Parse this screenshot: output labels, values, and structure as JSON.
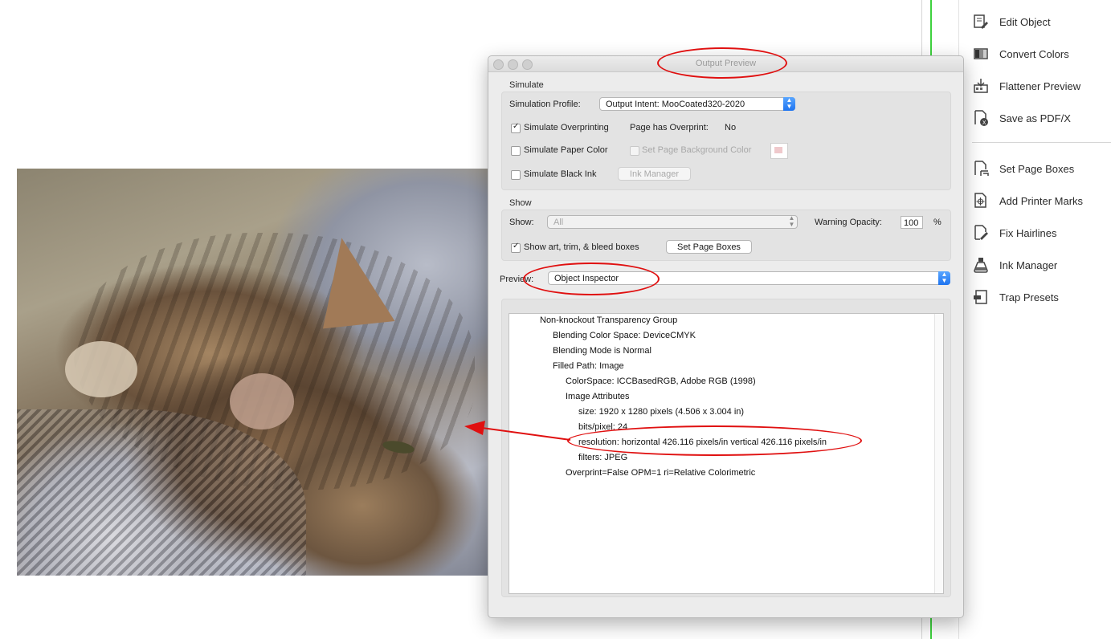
{
  "dialog": {
    "title": "Output Preview",
    "simulate": {
      "group_label": "Simulate",
      "profile_label": "Simulation Profile:",
      "profile_value": "Output Intent: MooCoated320-2020",
      "overprinting_label": "Simulate Overprinting",
      "overprinting_checked": true,
      "overprint_status_label": "Page has Overprint:",
      "overprint_status_value": "No",
      "paper_color_label": "Simulate Paper Color",
      "page_bg_label": "Set Page Background Color",
      "black_ink_label": "Simulate Black Ink",
      "ink_manager_button": "Ink Manager"
    },
    "show": {
      "group_label": "Show",
      "show_label": "Show:",
      "show_value": "All",
      "warning_opacity_label": "Warning Opacity:",
      "warning_opacity_value": "100",
      "percent_sign": "%",
      "boxes_label": "Show art, trim, & bleed boxes",
      "boxes_checked": true,
      "set_page_boxes_button": "Set Page Boxes"
    },
    "preview": {
      "label": "Preview:",
      "value": "Object Inspector"
    },
    "inspector_lines": [
      "Non-knockout Transparency Group",
      "Blending Color Space: DeviceCMYK",
      "Blending Mode is Normal",
      "Filled Path: Image",
      "ColorSpace: ICCBasedRGB, Adobe RGB (1998)",
      "Image Attributes",
      "size: 1920 x 1280 pixels (4.506 x 3.004 in)",
      "bits/pixel: 24",
      "resolution: horizontal 426.116 pixels/in vertical 426.116 pixels/in",
      "filters: JPEG",
      "Overprint=False OPM=1 ri=Relative Colorimetric"
    ]
  },
  "tools": [
    {
      "label": "Edit Object",
      "icon": "edit-object-icon"
    },
    {
      "label": "Convert Colors",
      "icon": "convert-colors-icon"
    },
    {
      "label": "Flattener Preview",
      "icon": "flattener-preview-icon"
    },
    {
      "label": "Save as PDF/X",
      "icon": "save-pdfx-icon"
    },
    {
      "label": "Set Page Boxes",
      "icon": "set-page-boxes-icon"
    },
    {
      "label": "Add Printer Marks",
      "icon": "printer-marks-icon"
    },
    {
      "label": "Fix Hairlines",
      "icon": "fix-hairlines-icon"
    },
    {
      "label": "Ink Manager",
      "icon": "ink-manager-icon"
    },
    {
      "label": "Trap Presets",
      "icon": "trap-presets-icon"
    }
  ],
  "colors": {
    "annotation_red": "#e01010",
    "accent_blue": "#1e74f0",
    "guide_green": "#3ed23e"
  }
}
